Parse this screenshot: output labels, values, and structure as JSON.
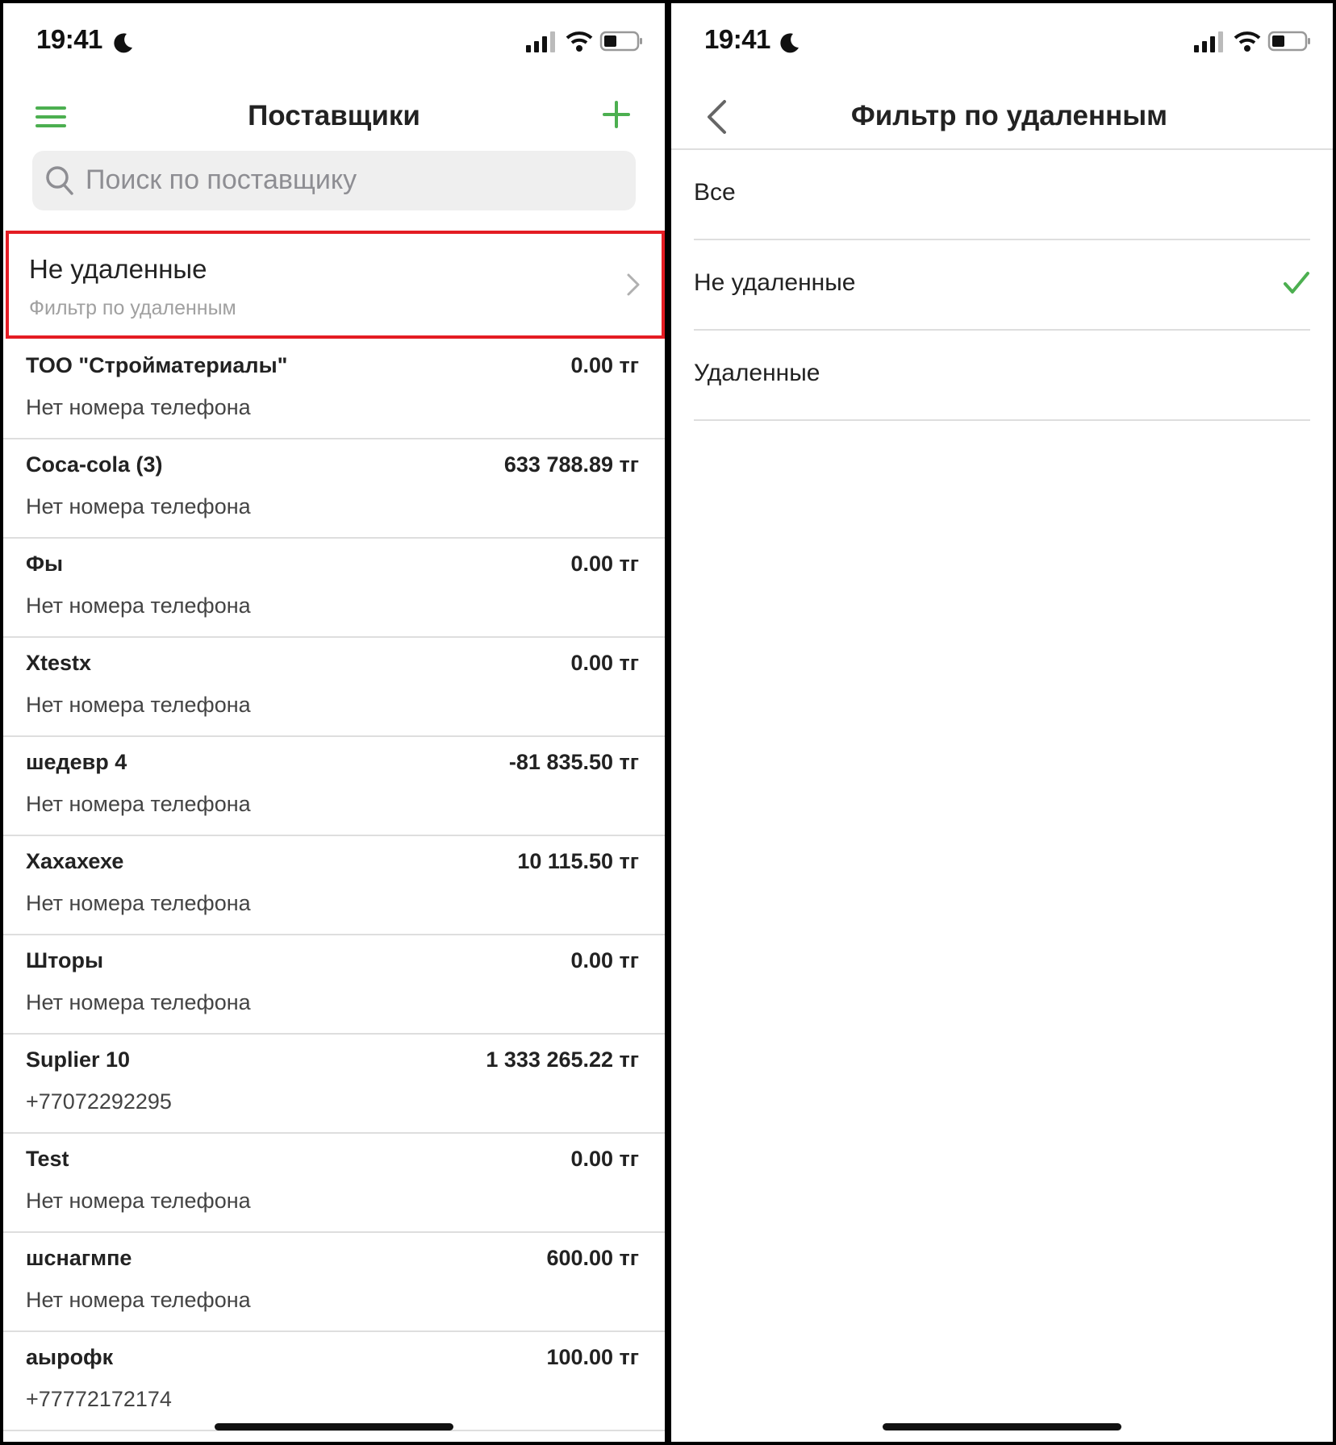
{
  "colors": {
    "accent_green": "#4caf50",
    "highlight_red": "#e41c23"
  },
  "status_bar": {
    "time": "19:41"
  },
  "suppliers_screen": {
    "title": "Поставщики",
    "search": {
      "placeholder": "Поиск по поставщику"
    },
    "filter": {
      "title": "Не удаленные",
      "subtitle": "Фильтр по удаленным"
    },
    "items": [
      {
        "name": "ТОО \"Стройматериалы\"",
        "amount": "0.00 тг",
        "phone": "Нет номера телефона"
      },
      {
        "name": "Coca-cola (3)",
        "amount": "633 788.89 тг",
        "phone": "Нет номера телефона"
      },
      {
        "name": "Фы",
        "amount": "0.00 тг",
        "phone": "Нет номера телефона"
      },
      {
        "name": "Xtestx",
        "amount": "0.00 тг",
        "phone": "Нет номера телефона"
      },
      {
        "name": "шедевр 4",
        "amount": "-81 835.50 тг",
        "phone": "Нет номера телефона"
      },
      {
        "name": "Хахахехе",
        "amount": "10 115.50 тг",
        "phone": "Нет номера телефона"
      },
      {
        "name": "Шторы",
        "amount": "0.00 тг",
        "phone": "Нет номера телефона"
      },
      {
        "name": "Suplier 10",
        "amount": "1 333 265.22 тг",
        "phone": "+77072292295"
      },
      {
        "name": "Test",
        "amount": "0.00 тг",
        "phone": "Нет номера телефона"
      },
      {
        "name": "шснагмпе",
        "amount": "600.00 тг",
        "phone": "Нет номера телефона"
      },
      {
        "name": "аырофк",
        "amount": "100.00 тг",
        "phone": "+77772172174"
      }
    ]
  },
  "filter_screen": {
    "title": "Фильтр по удаленным",
    "options": [
      {
        "label": "Все",
        "selected": false
      },
      {
        "label": "Не удаленные",
        "selected": true
      },
      {
        "label": "Удаленные",
        "selected": false
      }
    ]
  }
}
